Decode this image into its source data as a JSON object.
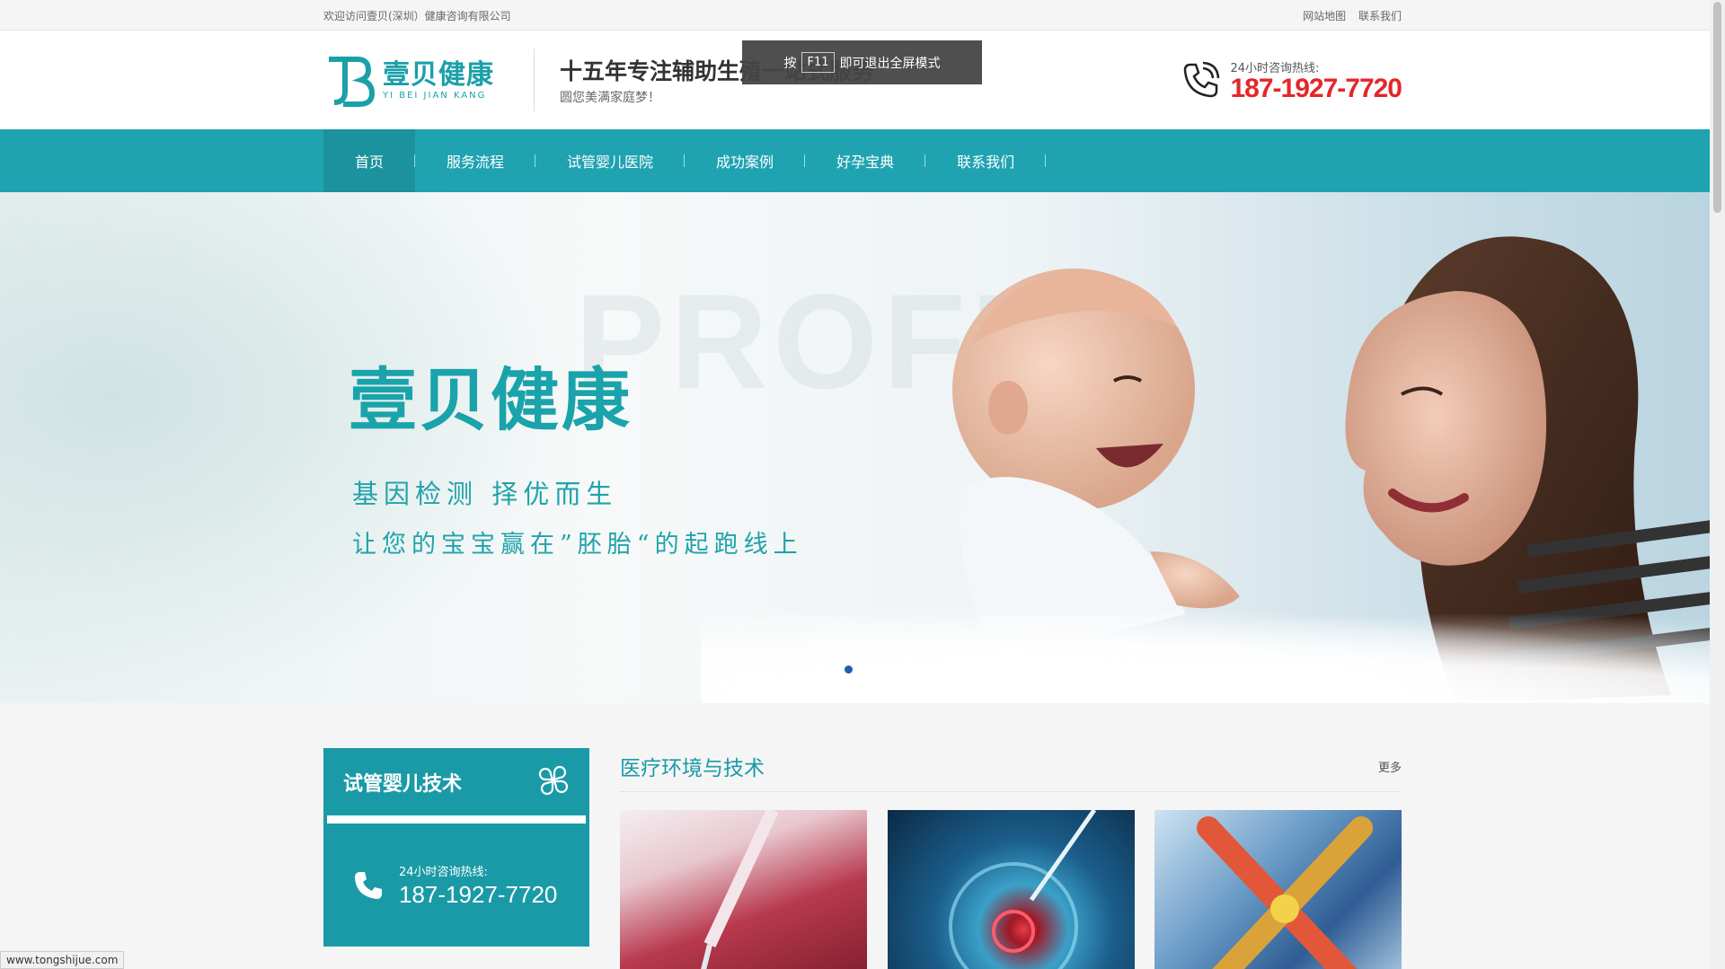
{
  "topbar": {
    "welcome": "欢迎访问壹贝(深圳）健康咨询有限公司",
    "links": [
      "网站地图",
      "联系我们"
    ]
  },
  "header": {
    "logo_cn": "壹贝健康",
    "logo_en": "YI BEI JIAN KANG",
    "slogan_main": "十五年专注辅助生殖一站式服务",
    "slogan_sub": "圆您美满家庭梦！",
    "hotline_label": "24小时咨询热线:",
    "hotline_number": "187-1927-7720"
  },
  "fullscreen_hint": {
    "prefix": "按",
    "key": "F11",
    "suffix": "即可退出全屏模式"
  },
  "nav": {
    "items": [
      {
        "label": "首页",
        "active": true
      },
      {
        "label": "服务流程"
      },
      {
        "label": "试管婴儿医院"
      },
      {
        "label": "成功案例"
      },
      {
        "label": "好孕宝典"
      },
      {
        "label": "联系我们"
      }
    ]
  },
  "banner": {
    "title": "壹贝健康",
    "line1": "基因检测  择优而生",
    "line2": "让您的宝宝赢在”胚胎“的起跑线上",
    "watermark": "PROFE"
  },
  "sidebox": {
    "title": "试管婴儿技术",
    "tel_label": "24小时咨询热线:",
    "tel_number": "187-1927-7720"
  },
  "section": {
    "title": "医疗环境与技术",
    "more": "更多"
  },
  "status_url": "www.tongshijue.com",
  "colors": {
    "accent": "#1fa3b1",
    "hotline_red": "#e4262a"
  }
}
